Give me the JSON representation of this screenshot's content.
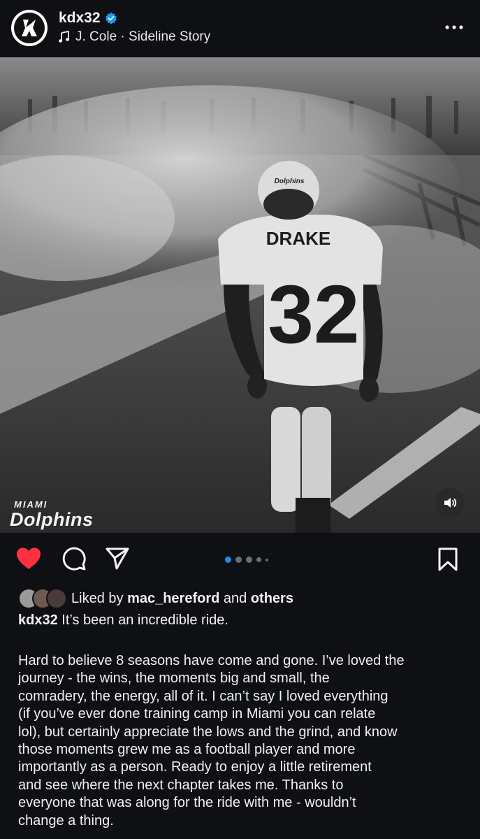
{
  "post": {
    "username": "kdx32",
    "verified": true,
    "audio": "J. Cole · Sideline Story",
    "icons": {
      "avatar": "kdx32-logo-icon",
      "verified": "verified-badge-icon",
      "music": "music-note-icon",
      "more": "more-options-icon",
      "sound": "speaker-icon",
      "like": "heart-icon",
      "comment": "comment-icon",
      "share": "share-icon",
      "save": "bookmark-icon"
    }
  },
  "photo": {
    "brand_top": "MIAMI",
    "brand_main": "Dolphins",
    "jersey_name": "DRAKE",
    "jersey_number": "32",
    "helmet_text": "Dolphins"
  },
  "carousel": {
    "count": 5,
    "active_index": 0,
    "active_color": "#1d8cf0"
  },
  "actions": {
    "liked": true,
    "like_color": "#ff3040"
  },
  "likes": {
    "prefix": "Liked by",
    "user": "mac_hereford",
    "joiner": "and",
    "others": "others"
  },
  "caption": {
    "username": "kdx32",
    "first_line": "It’s been an incredible ride.",
    "body": "Hard to believe 8 seasons have come and gone. I’ve loved the\njourney - the wins, the moments big and small, the\ncomradery, the energy, all of it.  I can’t say I loved everything\n(if you’ve ever done training camp in Miami you can relate\nlol), but certainly appreciate the lows and the grind, and know\nthose moments grew me as a football player and more\nimportantly as a person.  Ready to enjoy a little retirement\nand see where the next chapter takes me. Thanks to\neveryone that was along for the ride with me - wouldn’t\nchange a thing."
  }
}
